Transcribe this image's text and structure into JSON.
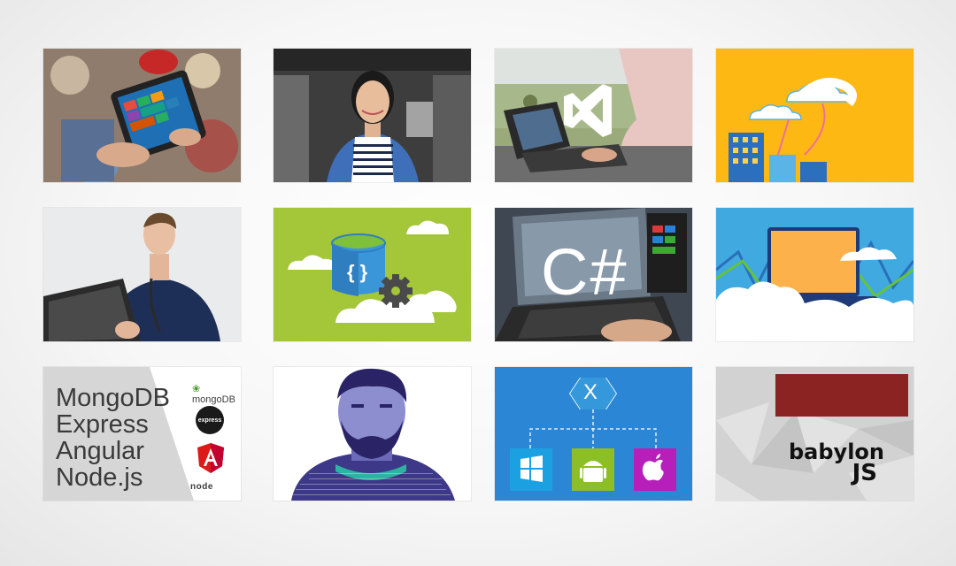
{
  "tiles": [
    {
      "name": "tile-tablet-painting",
      "interactable": true
    },
    {
      "name": "tile-woman-portrait",
      "interactable": true
    },
    {
      "name": "tile-visual-studio",
      "interactable": true
    },
    {
      "name": "tile-cloud-city",
      "interactable": true
    },
    {
      "name": "tile-doctor-laptop",
      "interactable": true
    },
    {
      "name": "tile-azure-data-cloud",
      "interactable": true
    },
    {
      "name": "tile-csharp",
      "interactable": true
    },
    {
      "name": "tile-cloud-laptop",
      "interactable": true
    },
    {
      "name": "tile-mean-stack",
      "interactable": true
    },
    {
      "name": "tile-bearded-man",
      "interactable": true
    },
    {
      "name": "tile-xamarin",
      "interactable": true
    },
    {
      "name": "tile-babylonjs",
      "interactable": true
    }
  ],
  "csharp": {
    "label": "C#"
  },
  "mean": {
    "lines": [
      "MongoDB",
      "Express",
      "Angular",
      "Node.js"
    ],
    "mongo_logo": "mongoDB",
    "express_logo": "express",
    "node_logo": "node"
  },
  "xamarin": {
    "logo": "X"
  },
  "babylon": {
    "word": "babylon",
    "js": "JS"
  },
  "colors": {
    "accent_yellow": "#FDB813",
    "azure_green": "#A4C639",
    "sky_blue": "#3FA9E0",
    "xamarin_blue": "#2C86D6",
    "windows_blue": "#1BA1E2",
    "android_green": "#8CBF26",
    "apple_purple": "#B61FBA",
    "babylon_red": "#8B2323"
  }
}
